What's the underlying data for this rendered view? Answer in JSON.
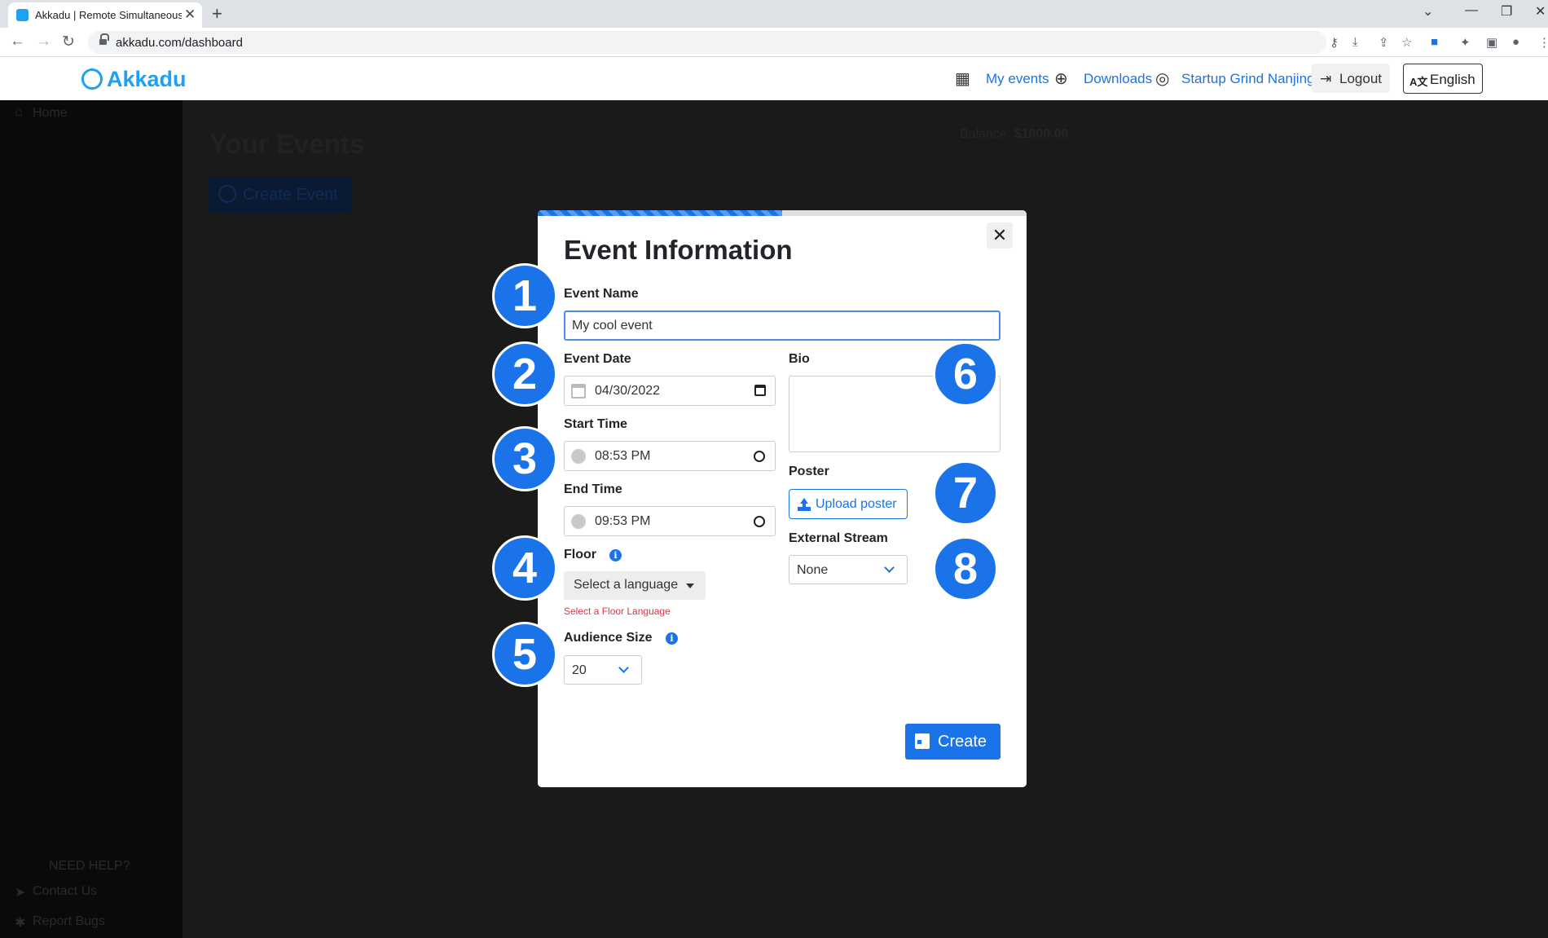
{
  "browser": {
    "tab_title": "Akkadu | Remote Simultaneous",
    "tab_close": "✕",
    "new_tab": "+",
    "url": "akkadu.com/dashboard"
  },
  "header": {
    "logo": "Akkadu",
    "my_events": "My events",
    "downloads": "Downloads",
    "account": "Startup Grind Nanjing",
    "logout": "Logout",
    "language": "English",
    "language_icon": "A文"
  },
  "background": {
    "sidebar_home": "Home",
    "need_help": "NEED HELP?",
    "contact_us": "Contact Us",
    "report_bugs": "Report Bugs",
    "page_title": "Your Events",
    "create_event": "Create Event",
    "balance_label": "Balance:",
    "balance_value": "$1000.00"
  },
  "modal": {
    "title": "Event Information",
    "progress": 0.5,
    "close": "✕",
    "event_name_label": "Event Name",
    "event_name_value": "My cool event",
    "event_date_label": "Event Date",
    "event_date_value": "04/30/2022",
    "start_time_label": "Start Time",
    "start_time_value": "08:53 PM",
    "end_time_label": "End Time",
    "end_time_value": "09:53 PM",
    "floor_label": "Floor",
    "floor_select": "Select a language",
    "floor_error": "Select a Floor Language",
    "audience_label": "Audience Size",
    "audience_value": "20",
    "bio_label": "Bio",
    "poster_label": "Poster",
    "upload_poster": "Upload poster",
    "external_stream_label": "External Stream",
    "external_stream_value": "None",
    "create": "Create"
  },
  "badges": [
    "1",
    "2",
    "3",
    "4",
    "5",
    "6",
    "7",
    "8"
  ],
  "colors": {
    "accent": "#1a73e8",
    "brand": "#1ea1f1",
    "error": "#dc3545"
  }
}
